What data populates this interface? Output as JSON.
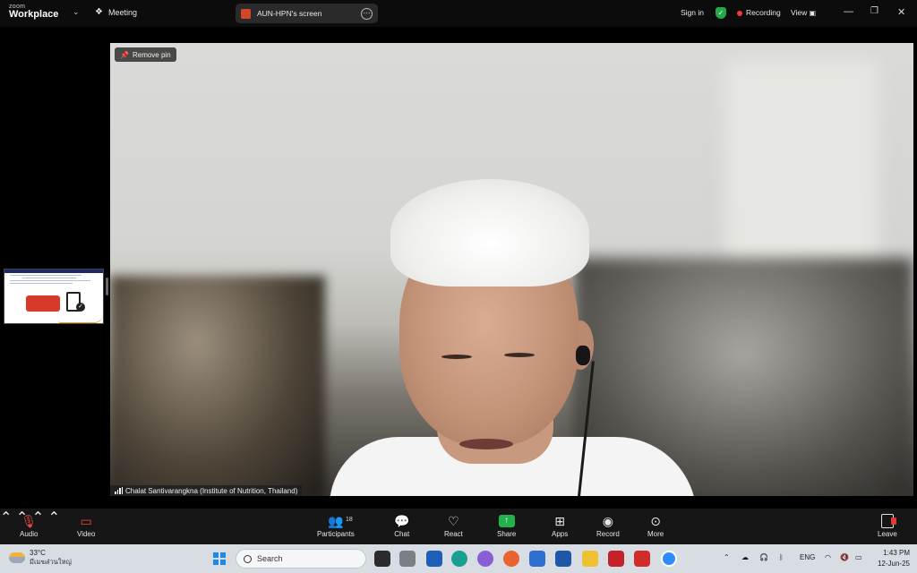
{
  "titlebar": {
    "logo_line1": "zoom",
    "logo_line2": "Workplace",
    "meeting_label": "Meeting",
    "screen_share_label": "AUN-HPN's screen",
    "sign_in": "Sign in",
    "recording": "Recording",
    "view": "View"
  },
  "stage": {
    "remove_pin": "Remove pin",
    "participant_name": "Chalat Santivarangkna (Institute of Nutrition, Thailand)"
  },
  "toolbar": {
    "audio": "Audio",
    "video": "Video",
    "participants": "Participants",
    "participants_count": "18",
    "chat": "Chat",
    "react": "React",
    "share": "Share",
    "apps": "Apps",
    "record": "Record",
    "more": "More",
    "leave": "Leave"
  },
  "taskbar": {
    "temperature": "33°C",
    "weather_text": "มีเมฆส่วนใหญ่",
    "search_placeholder": "Search",
    "language": "ENG",
    "time": "1:43 PM",
    "date": "12-Jun-25"
  },
  "colors": {
    "recording_dot": "#f03a3a",
    "shield_green": "#23a94a",
    "share_green": "#22b14c",
    "toolbar_bg": "#161616",
    "taskbar_bg": "#d8dde4"
  }
}
